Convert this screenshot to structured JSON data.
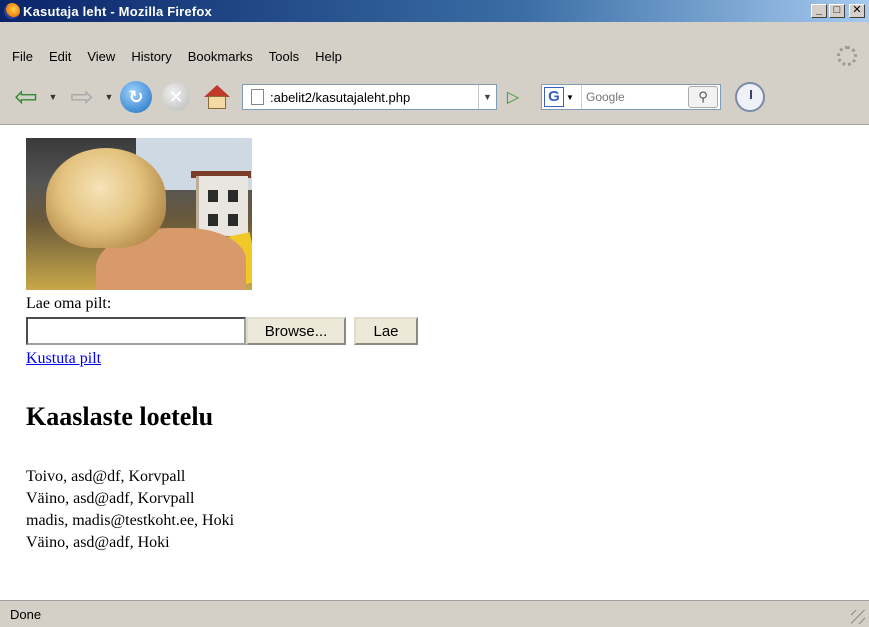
{
  "window": {
    "title": "Kasutaja leht - Mozilla Firefox",
    "controls": {
      "minimize": "_",
      "maximize": "□",
      "close": "✕"
    }
  },
  "menu": [
    "File",
    "Edit",
    "View",
    "History",
    "Bookmarks",
    "Tools",
    "Help"
  ],
  "navigation": {
    "url": ":abelit2/kasutajaleht.php",
    "search_placeholder": "Google",
    "search_engine_letter": "G",
    "icons": {
      "back": "back-arrow-icon",
      "forward": "forward-arrow-icon",
      "reload": "reload-icon",
      "stop": "stop-icon",
      "home": "home-icon",
      "go": "go-icon",
      "search": "magnifier-icon",
      "history": "clock-icon"
    }
  },
  "page": {
    "upload_label": "Lae oma pilt:",
    "browse_button": "Browse...",
    "upload_button": "Lae",
    "delete_link": "Kustuta pilt",
    "friends_heading": "Kaaslaste loetelu",
    "friends": [
      "Toivo, asd@df, Korvpall",
      "Väino, asd@adf, Korvpall",
      "madis, madis@testkoht.ee, Hoki",
      "Väino, asd@adf, Hoki"
    ]
  },
  "status": {
    "text": "Done"
  },
  "colors": {
    "link": "#0000ee",
    "titlebar": "#0a246a",
    "chrome": "#d4d0c8"
  }
}
